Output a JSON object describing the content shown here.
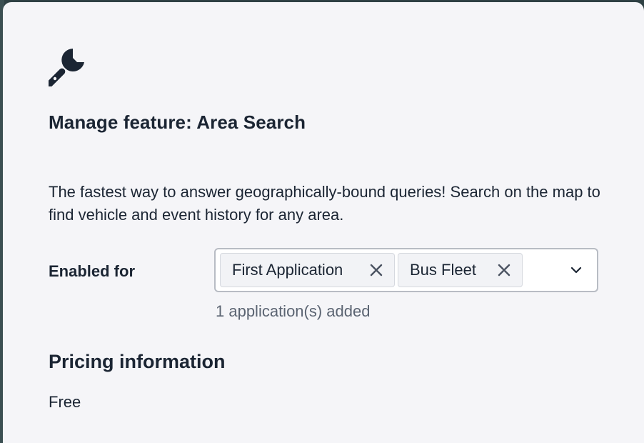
{
  "modal": {
    "icon": "wrench-icon",
    "title": "Manage feature: Area Search",
    "description": "The fastest way to answer geographically-bound queries! Search on the map to find vehicle and event history for any area."
  },
  "enabled_for": {
    "label": "Enabled for",
    "selected": [
      {
        "label": "First Application",
        "remove_icon": "close-icon"
      },
      {
        "label": "Bus Fleet",
        "remove_icon": "close-icon"
      }
    ],
    "dropdown_icon": "chevron-down-icon",
    "helper_text": "1 application(s) added"
  },
  "pricing": {
    "heading": "Pricing information",
    "value": "Free"
  },
  "colors": {
    "modal_bg": "#f5f5f8",
    "text_primary": "#1b2533",
    "text_secondary": "#5b6472",
    "border": "#b8bcc4",
    "backdrop": "#2f4144"
  }
}
